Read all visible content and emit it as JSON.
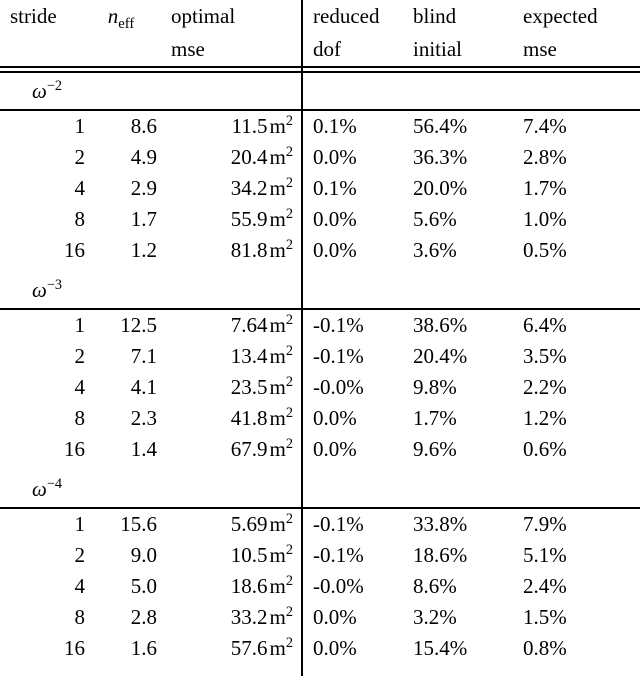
{
  "table": {
    "columns": {
      "stride": {
        "line1": "stride",
        "line2": ""
      },
      "n_eff": {
        "var": "n",
        "sub": "eff",
        "line2": ""
      },
      "optimal_mse": {
        "line1": "optimal",
        "line2": "mse"
      },
      "reduced_dof": {
        "line1": "reduced",
        "line2": "dof"
      },
      "blind_initial": {
        "line1": "blind",
        "line2": "initial"
      },
      "expected_mse": {
        "line1": "expected",
        "line2": "mse"
      }
    },
    "unit": {
      "symbol": "m",
      "exponent": "2"
    },
    "groups": [
      {
        "label_base": "ω",
        "label_exponent": "−2",
        "rows": [
          {
            "stride": "1",
            "n_eff": "8.6",
            "optimal_mse": "11.5",
            "reduced_dof": "0.1%",
            "blind_initial": "56.4%",
            "expected_mse": "7.4%"
          },
          {
            "stride": "2",
            "n_eff": "4.9",
            "optimal_mse": "20.4",
            "reduced_dof": "0.0%",
            "blind_initial": "36.3%",
            "expected_mse": "2.8%"
          },
          {
            "stride": "4",
            "n_eff": "2.9",
            "optimal_mse": "34.2",
            "reduced_dof": "0.1%",
            "blind_initial": "20.0%",
            "expected_mse": "1.7%"
          },
          {
            "stride": "8",
            "n_eff": "1.7",
            "optimal_mse": "55.9",
            "reduced_dof": "0.0%",
            "blind_initial": "5.6%",
            "expected_mse": "1.0%"
          },
          {
            "stride": "16",
            "n_eff": "1.2",
            "optimal_mse": "81.8",
            "reduced_dof": "0.0%",
            "blind_initial": "3.6%",
            "expected_mse": "0.5%"
          }
        ]
      },
      {
        "label_base": "ω",
        "label_exponent": "−3",
        "rows": [
          {
            "stride": "1",
            "n_eff": "12.5",
            "optimal_mse": "7.64",
            "reduced_dof": "-0.1%",
            "blind_initial": "38.6%",
            "expected_mse": "6.4%"
          },
          {
            "stride": "2",
            "n_eff": "7.1",
            "optimal_mse": "13.4",
            "reduced_dof": "-0.1%",
            "blind_initial": "20.4%",
            "expected_mse": "3.5%"
          },
          {
            "stride": "4",
            "n_eff": "4.1",
            "optimal_mse": "23.5",
            "reduced_dof": "-0.0%",
            "blind_initial": "9.8%",
            "expected_mse": "2.2%"
          },
          {
            "stride": "8",
            "n_eff": "2.3",
            "optimal_mse": "41.8",
            "reduced_dof": "0.0%",
            "blind_initial": "1.7%",
            "expected_mse": "1.2%"
          },
          {
            "stride": "16",
            "n_eff": "1.4",
            "optimal_mse": "67.9",
            "reduced_dof": "0.0%",
            "blind_initial": "9.6%",
            "expected_mse": "0.6%"
          }
        ]
      },
      {
        "label_base": "ω",
        "label_exponent": "−4",
        "rows": [
          {
            "stride": "1",
            "n_eff": "15.6",
            "optimal_mse": "5.69",
            "reduced_dof": "-0.1%",
            "blind_initial": "33.8%",
            "expected_mse": "7.9%"
          },
          {
            "stride": "2",
            "n_eff": "9.0",
            "optimal_mse": "10.5",
            "reduced_dof": "-0.1%",
            "blind_initial": "18.6%",
            "expected_mse": "5.1%"
          },
          {
            "stride": "4",
            "n_eff": "5.0",
            "optimal_mse": "18.6",
            "reduced_dof": "-0.0%",
            "blind_initial": "8.6%",
            "expected_mse": "2.4%"
          },
          {
            "stride": "8",
            "n_eff": "2.8",
            "optimal_mse": "33.2",
            "reduced_dof": "0.0%",
            "blind_initial": "3.2%",
            "expected_mse": "1.5%"
          },
          {
            "stride": "16",
            "n_eff": "1.6",
            "optimal_mse": "57.6",
            "reduced_dof": "0.0%",
            "blind_initial": "15.4%",
            "expected_mse": "0.8%"
          }
        ]
      }
    ]
  }
}
